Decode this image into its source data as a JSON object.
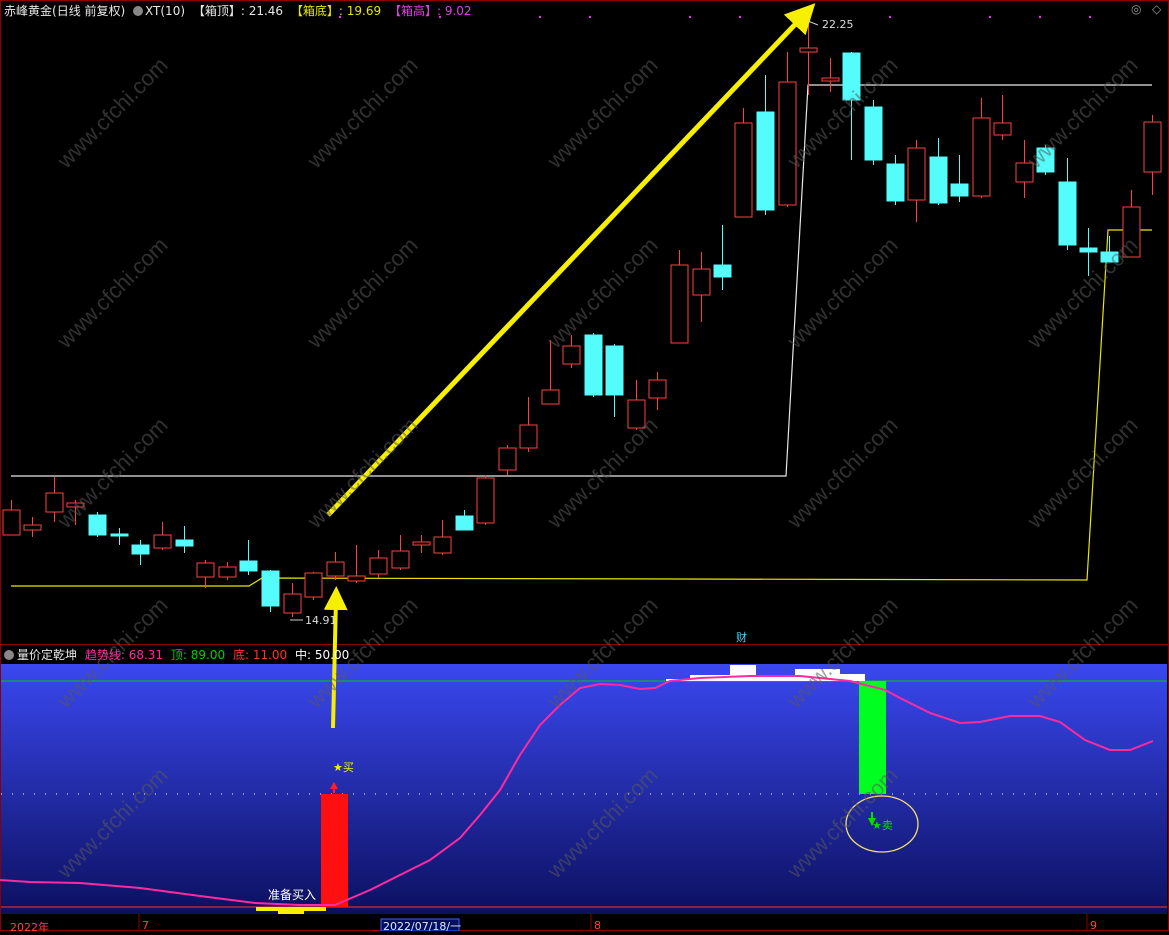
{
  "top_panel": {
    "stock_name": "赤峰黄金",
    "period": "(日线 前复权)",
    "indicator_name": "XT(10)",
    "box_top_label": "【箱顶】",
    "box_top_value": ": 21.46",
    "box_bottom_label": "【箱底】",
    "box_bottom_value": ": 19.69",
    "box_height_label": "【箱高】",
    "box_height_value": ": 9.02",
    "high_marker": "22.25",
    "low_marker": "14.91",
    "cai_marker": "财",
    "colors": {
      "box_top": "#e8e8e8",
      "box_bottom": "#e8e800",
      "box_height": "#e040e0",
      "up": "#ff4040",
      "down": "#54fcfc"
    }
  },
  "bottom_panel": {
    "indicator_name": "量价定乾坤",
    "trend_label": "趋势线",
    "trend_value": ": 68.31",
    "top_label": "顶",
    "top_value": ": 89.00",
    "bottom_label": "底",
    "bottom_value": ": 11.00",
    "mid_label": "中",
    "mid_value": ": 50.00",
    "buy_signal": "★买",
    "sell_signal": "★卖",
    "prepare_buy": "准备买入",
    "colors": {
      "trend": "#ff2aa0",
      "top": "#00d000",
      "bottom": "#ff3030",
      "mid": "#ffffff"
    }
  },
  "time_axis": {
    "labels": [
      "2022年",
      "7",
      "2022/07/18/一",
      "8",
      "9"
    ]
  },
  "watermark": "www.cfchi.com",
  "icons": [
    "collapse-icon",
    "settings-icon",
    "close-icon",
    "diamond-icon"
  ]
}
